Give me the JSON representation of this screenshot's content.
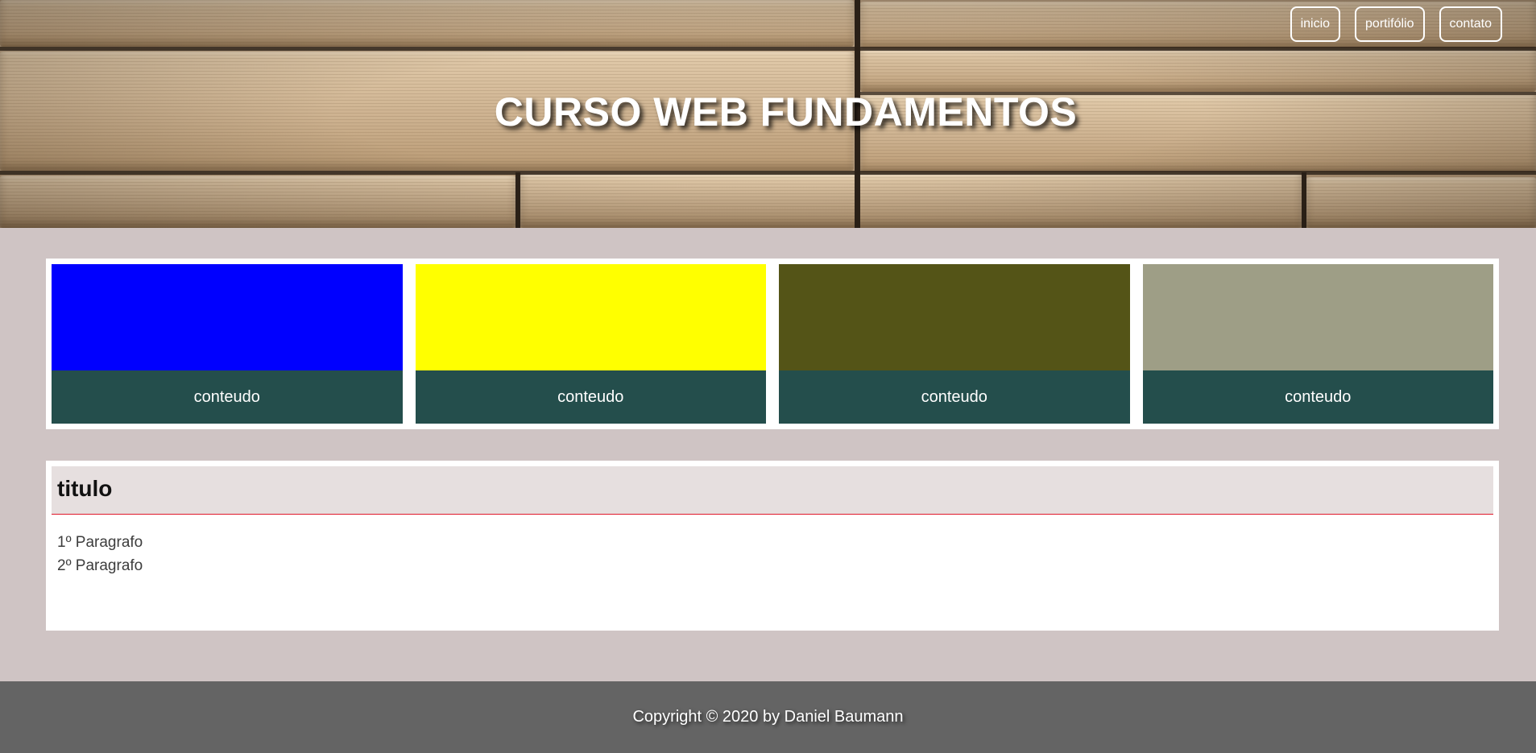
{
  "header": {
    "title": "CURSO WEB FUNDAMENTOS",
    "nav": [
      {
        "label": "inicio"
      },
      {
        "label": "portifólio"
      },
      {
        "label": "contato"
      }
    ]
  },
  "cards": [
    {
      "color": "#0000ff",
      "text": "conteudo"
    },
    {
      "color": "#ffff00",
      "text": "conteudo"
    },
    {
      "color": "#545417",
      "text": "conteudo"
    },
    {
      "color": "#9e9e86",
      "text": "conteudo"
    }
  ],
  "article": {
    "title": "titulo",
    "paragraphs": [
      "1º Paragrafo",
      "2º Paragrafo"
    ]
  },
  "footer": {
    "copyright": "Copyright © 2020 by Daniel Baumann"
  },
  "colors": {
    "page_background": "#cfc4c4",
    "card_caption_background": "#244e4c",
    "article_header_background": "#e6dfdf",
    "article_header_border": "#e0192b",
    "footer_background": "#646464"
  }
}
